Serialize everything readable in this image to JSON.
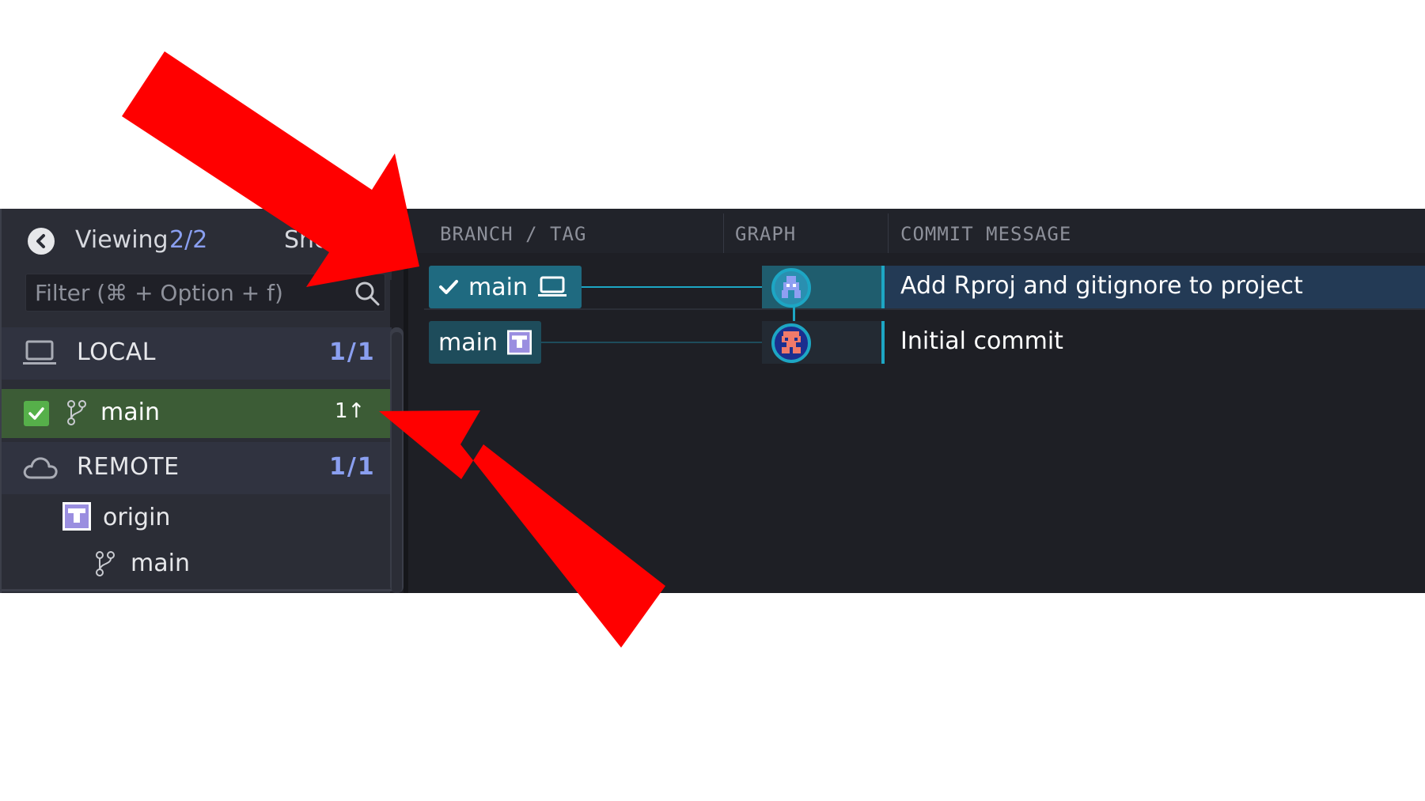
{
  "sidebar": {
    "viewing_label": "Viewing",
    "viewing_count": "2/2",
    "show_label": "Sho",
    "filter_placeholder": "Filter (⌘ + Option + f)",
    "local": {
      "title": "LOCAL",
      "count": "1/1"
    },
    "local_branch": {
      "name": "main",
      "ahead": "1↑",
      "checked": true
    },
    "remote": {
      "title": "REMOTE",
      "count": "1/1"
    },
    "remote_name": "origin",
    "remote_branch": "main"
  },
  "graph": {
    "columns": [
      "BRANCH / TAG",
      "GRAPH",
      "COMMIT MESSAGE"
    ],
    "commits": [
      {
        "ref": "main",
        "message": "Add Rproj and gitignore to project",
        "selected": true
      },
      {
        "ref": "main",
        "message": "Initial commit",
        "selected": false
      }
    ]
  },
  "colors": {
    "arrow": "#ff0000",
    "selected_branch_row": "#3c5c36",
    "accent_count": "#8a9ff0",
    "graph_line": "#1da6c4"
  },
  "icons": [
    "chevron-left-icon",
    "search-icon",
    "laptop-icon",
    "branch-icon",
    "cloud-icon",
    "check-icon",
    "avatar-icon"
  ]
}
